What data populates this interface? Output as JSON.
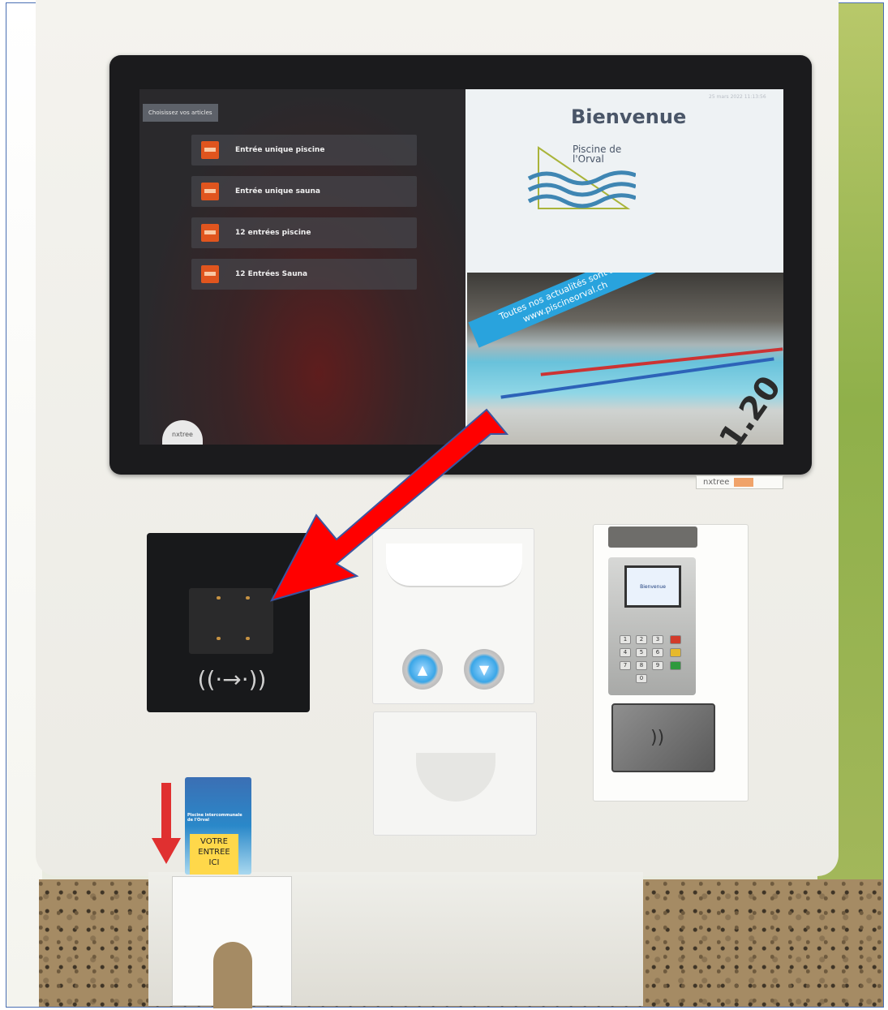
{
  "kiosk_screen": {
    "left_panel": {
      "header_chip": "Choisissez vos articles",
      "articles": [
        {
          "label": "Entrée unique piscine",
          "icon": "ticket-icon"
        },
        {
          "label": "Entrée unique sauna",
          "icon": "ticket-icon"
        },
        {
          "label": "12 entrées piscine",
          "icon": "ticket-icon"
        },
        {
          "label": "12 Entrées Sauna",
          "icon": "ticket-icon"
        }
      ],
      "vendor_badge": "nxtree"
    },
    "right_panel": {
      "clock": "25 mars 2022 11:13:56",
      "welcome_title": "Bienvenue",
      "logo_text": "Piscine de l'Orval",
      "banner_lines": [
        "Toutes nos actualités sont sur",
        "www.piscineorval.ch"
      ],
      "depth_mark": "1.20"
    }
  },
  "brand_sticker": "nxtree",
  "card_reader": {
    "icon": "contactless-icon",
    "glyph": "((·→·))"
  },
  "ticket_unit": {
    "up_button": "▲",
    "down_button": "▼"
  },
  "payment_terminal": {
    "screen_text": "Bienvenue",
    "keys": [
      "1",
      "2",
      "3",
      "4",
      "5",
      "6",
      "7",
      "8",
      "9",
      "0"
    ],
    "contactless_icon": "nfc-icon"
  },
  "entry_card": {
    "caption": "Piscine intercommunale de l'Orval",
    "label_lines": [
      "VOTRE",
      "ENTREE",
      "ICI"
    ]
  },
  "colors": {
    "arrow": "#ff0000",
    "ticket_icon": "#e0551e",
    "banner": "#29a3dd",
    "label": "#ffd84a"
  }
}
